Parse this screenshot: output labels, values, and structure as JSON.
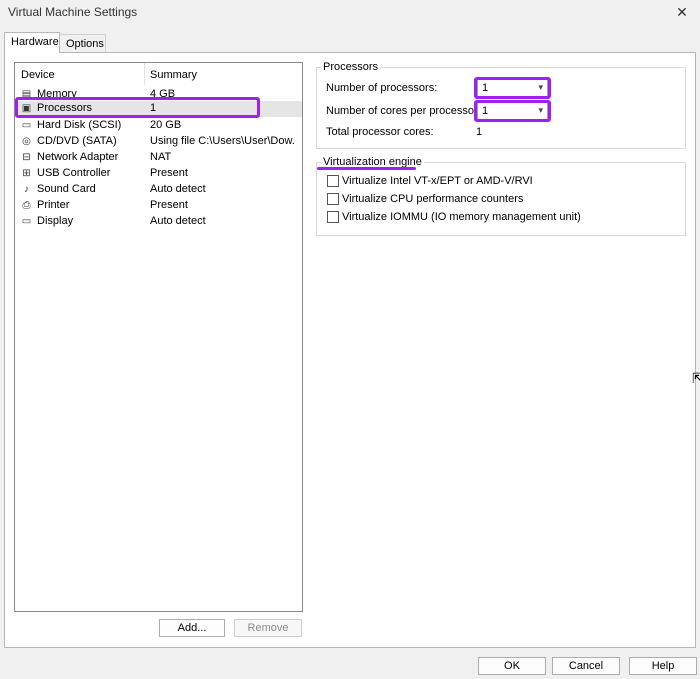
{
  "window": {
    "title": "Virtual Machine Settings",
    "close_glyph": "✕"
  },
  "tabs": [
    {
      "label": "Hardware",
      "active": true
    },
    {
      "label": "Options",
      "active": false
    }
  ],
  "device_list": {
    "headers": {
      "device": "Device",
      "summary": "Summary"
    },
    "rows": [
      {
        "icon": "memory-icon",
        "glyph": "▤",
        "name": "Memory",
        "summary": "4 GB"
      },
      {
        "icon": "processor-icon",
        "glyph": "▣",
        "name": "Processors",
        "summary": "1",
        "selected": true
      },
      {
        "icon": "hard-disk-icon",
        "glyph": "▭",
        "name": "Hard Disk (SCSI)",
        "summary": "20 GB"
      },
      {
        "icon": "cd-dvd-icon",
        "glyph": "◎",
        "name": "CD/DVD (SATA)",
        "summary": "Using file C:\\Users\\User\\Dow..."
      },
      {
        "icon": "network-adapter-icon",
        "glyph": "⊟",
        "name": "Network Adapter",
        "summary": "NAT"
      },
      {
        "icon": "usb-icon",
        "glyph": "⊞",
        "name": "USB Controller",
        "summary": "Present"
      },
      {
        "icon": "sound-icon",
        "glyph": "♪",
        "name": "Sound Card",
        "summary": "Auto detect"
      },
      {
        "icon": "printer-icon",
        "glyph": "⎙",
        "name": "Printer",
        "summary": "Present"
      },
      {
        "icon": "display-icon",
        "glyph": "▭",
        "name": "Display",
        "summary": "Auto detect"
      }
    ],
    "add_label": "Add...",
    "remove_label": "Remove"
  },
  "processors": {
    "group_title": "Processors",
    "num_processors_label": "Number of processors:",
    "num_processors_value": "1",
    "cores_label": "Number of cores per processor:",
    "cores_value": "1",
    "total_label": "Total processor cores:",
    "total_value": "1"
  },
  "virtualization": {
    "group_title": "Virtualization engine",
    "options": [
      {
        "label": "Virtualize Intel VT-x/EPT or AMD-V/RVI",
        "checked": false
      },
      {
        "label": "Virtualize CPU performance counters",
        "checked": false
      },
      {
        "label": "Virtualize IOMMU (IO memory management unit)",
        "checked": false
      }
    ]
  },
  "footer": {
    "ok": "OK",
    "cancel": "Cancel",
    "help": "Help"
  },
  "colors": {
    "highlight": "#a020f0",
    "selection": "#e5e5e5"
  }
}
